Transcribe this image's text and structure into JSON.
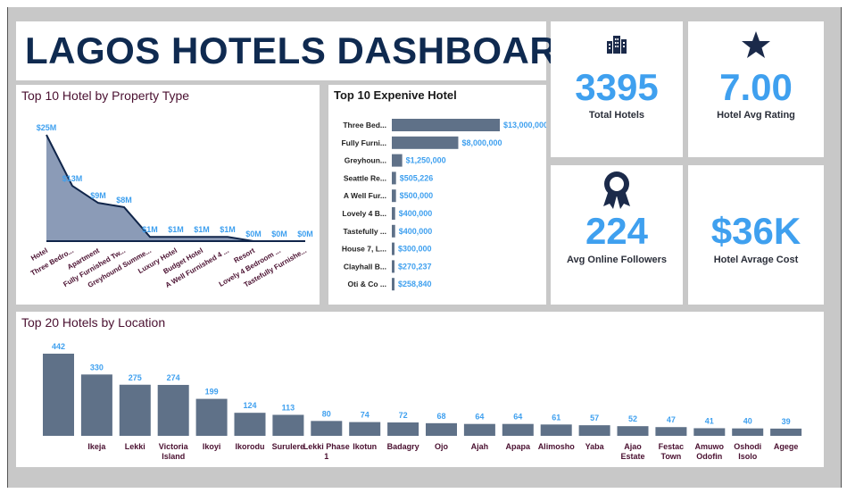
{
  "dashboard": {
    "title": "LAGOS HOTELS DASHBOARD"
  },
  "kpis": {
    "total_hotels": {
      "value": "3395",
      "label": "Total Hotels",
      "icon": "building-icon"
    },
    "avg_rating": {
      "value": "7.00",
      "label": "Hotel Avg Rating",
      "icon": "star-icon"
    },
    "avg_followers": {
      "value": "224",
      "label": "Avg Online Followers",
      "icon": "award-ribbon-icon"
    },
    "avg_cost": {
      "value": "$36K",
      "label": "Hotel Avrage Cost"
    }
  },
  "colors": {
    "accent": "#3fa0ef",
    "title": "#0f2a50",
    "bar": "#5f7188",
    "area": "#8b9bb7",
    "line": "#10254a",
    "label": "#4a1030"
  },
  "chart_data": [
    {
      "type": "area",
      "title": "Top 10 Hotel by Property Type",
      "categories": [
        "Hotel",
        "Three Bedro...",
        "Apartment",
        "Fully Furnished Tw...",
        "Greyhound Summe...",
        "Luxury Hotel",
        "Budget Hotel",
        "A Well Furnished 4 ...",
        "Resort",
        "Lovely 4 Bedroom ...",
        "Tastefully Furnishe..."
      ],
      "values": [
        25,
        13,
        9,
        8,
        1,
        1,
        1,
        1,
        0,
        0,
        0
      ],
      "data_labels": [
        "$25M",
        "$13M",
        "$9M",
        "$8M",
        "$1M",
        "$1M",
        "$1M",
        "$1M",
        "$0M",
        "$0M",
        "$0M"
      ],
      "unit": "$M"
    },
    {
      "type": "bar",
      "orientation": "horizontal",
      "title": "Top 10 Expenive Hotel",
      "categories": [
        "Three Bed...",
        "Fully Furni...",
        "Greyhoun...",
        "Seattle Re...",
        "A Well Fur...",
        "Lovely 4 B...",
        "Tastefully ...",
        "House 7, L...",
        "Clayhall B...",
        "Oti & Co ..."
      ],
      "values": [
        13000000,
        8000000,
        1250000,
        505226,
        500000,
        400000,
        400000,
        300000,
        270237,
        258840
      ],
      "data_labels": [
        "$13,000,000",
        "$8,000,000",
        "$1,250,000",
        "$505,226",
        "$500,000",
        "$400,000",
        "$400,000",
        "$300,000",
        "$270,237",
        "$258,840"
      ]
    },
    {
      "type": "bar",
      "title": "Top 20 Hotels by Location",
      "categories": [
        "",
        "Ikeja",
        "Lekki",
        "Victoria Island",
        "Ikoyi",
        "Ikorodu",
        "Surulere",
        "Lekki Phase 1",
        "Ikotun",
        "Badagry",
        "Ojo",
        "Ajah",
        "Apapa",
        "Alimosho",
        "Yaba",
        "Ajao Estate",
        "Festac Town",
        "Amuwo Odofin",
        "Oshodi Isolo",
        "Agege"
      ],
      "values": [
        442,
        330,
        275,
        274,
        199,
        124,
        113,
        80,
        74,
        72,
        68,
        64,
        64,
        61,
        57,
        52,
        47,
        41,
        40,
        39
      ]
    }
  ]
}
